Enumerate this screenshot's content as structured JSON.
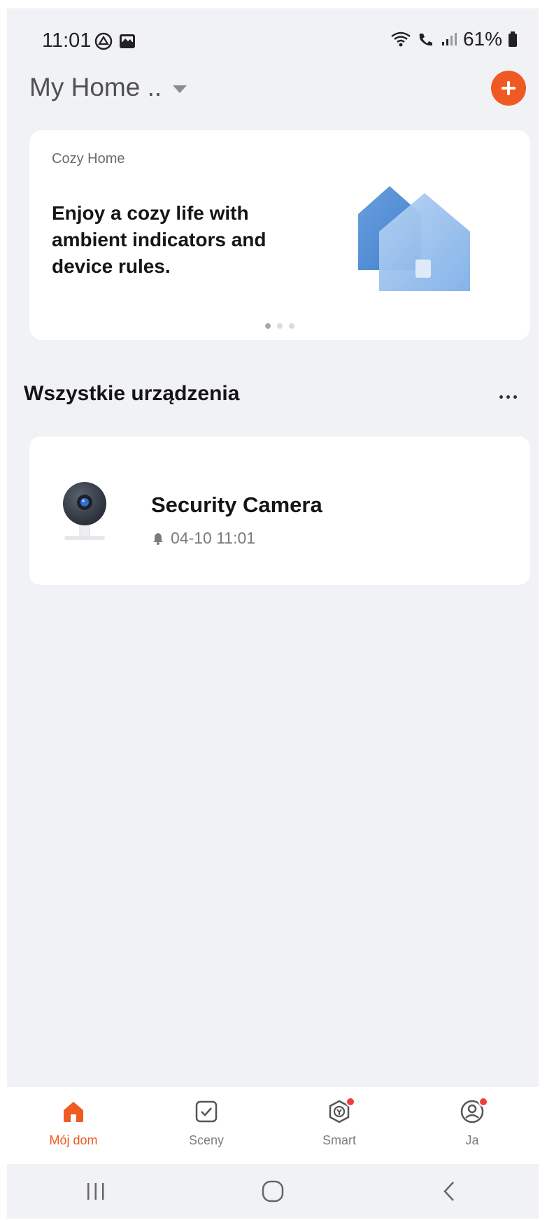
{
  "status_bar": {
    "time": "11:01",
    "battery": "61%"
  },
  "header": {
    "home_name": "My Home ..",
    "add_icon": "plus-circle-icon"
  },
  "banner": {
    "kicker": "Cozy Home",
    "heading": "Enjoy a cozy life with ambient indicators and device rules.",
    "page_count": 3,
    "active_page": 1
  },
  "section": {
    "title": "Wszystkie urządzenia"
  },
  "devices": [
    {
      "name": "Security Camera",
      "status": "04-10 11:01",
      "status_icon": "bell-icon"
    }
  ],
  "tabs": [
    {
      "label": "Mój dom",
      "icon": "home-icon",
      "active": true
    },
    {
      "label": "Sceny",
      "icon": "checkbox-icon",
      "active": false
    },
    {
      "label": "Smart",
      "icon": "smart-icon",
      "active": false,
      "badge": true
    },
    {
      "label": "Ja",
      "icon": "profile-icon",
      "active": false,
      "badge": true
    }
  ],
  "colors": {
    "accent": "#f05a22",
    "background": "#f1f2f6",
    "badge": "#f03c3c"
  }
}
